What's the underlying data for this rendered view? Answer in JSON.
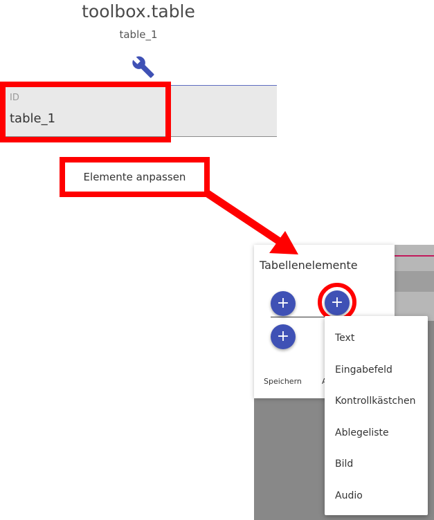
{
  "header": {
    "title": "toolbox.table",
    "subtitle": "table_1",
    "settings_icon": "wrench-icon"
  },
  "id_field": {
    "label": "ID",
    "value": "table_1"
  },
  "customize_button": {
    "label": "Elemente anpassen"
  },
  "table_elements_dialog": {
    "title": "Tabellenelemente",
    "add_icon": "plus-icon",
    "add_label": "+",
    "save_label": "Speichern",
    "second_action_fragment": "A"
  },
  "element_menu": {
    "items": [
      "Text",
      "Eingabefeld",
      "Kontrollkästchen",
      "Ablegeliste",
      "Bild",
      "Audio"
    ]
  },
  "colors": {
    "accent": "#3f51b5",
    "highlight": "#ff0000",
    "tab_indicator": "#5c6bc0"
  }
}
